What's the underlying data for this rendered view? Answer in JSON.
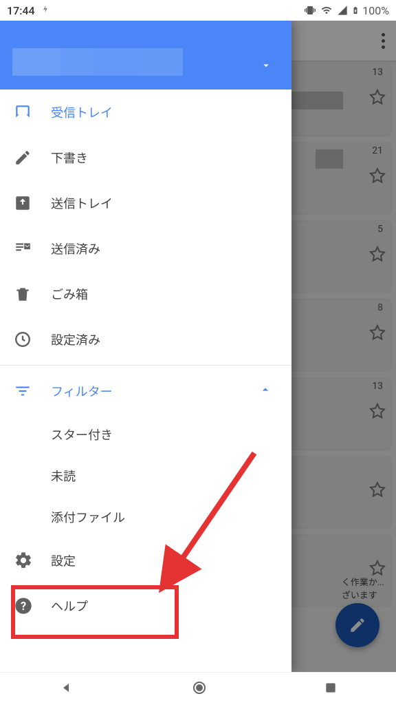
{
  "status": {
    "time": "17:44",
    "battery": "100%"
  },
  "drawer": {
    "items": [
      {
        "key": "inbox",
        "label": "受信トレイ"
      },
      {
        "key": "drafts",
        "label": "下書き"
      },
      {
        "key": "outbox",
        "label": "送信トレイ"
      },
      {
        "key": "sent",
        "label": "送信済み"
      },
      {
        "key": "trash",
        "label": "ごみ箱"
      },
      {
        "key": "scheduled",
        "label": "設定済み"
      }
    ],
    "filter_header": "フィルター",
    "filters": [
      {
        "key": "starred",
        "label": "スター付き"
      },
      {
        "key": "unread",
        "label": "未読"
      },
      {
        "key": "attach",
        "label": "添付ファイル"
      }
    ],
    "settings_label": "設定",
    "help_label": "ヘルプ"
  },
  "mail_badges": [
    "13",
    "21",
    "5",
    "8",
    "13"
  ],
  "colors": {
    "accent": "#4a86f7",
    "highlight": "#e53333",
    "fab": "#1a57b8"
  }
}
